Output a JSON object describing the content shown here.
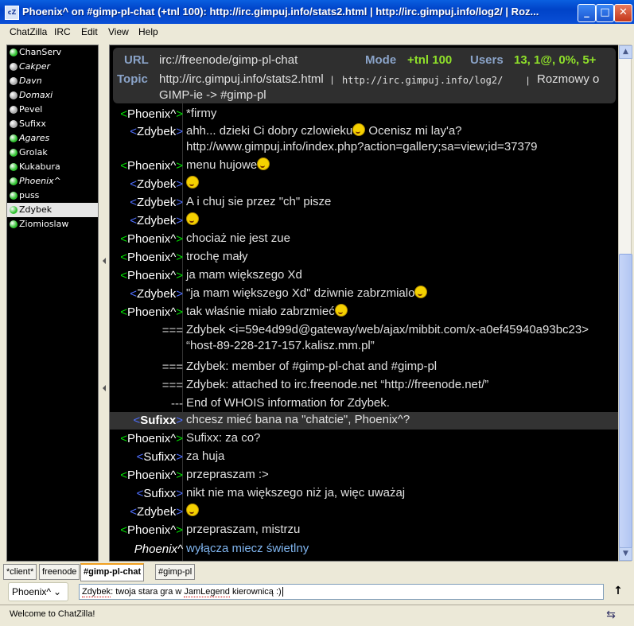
{
  "window": {
    "title": "Phoenix^ on #gimp-pl-chat (+tnl 100): http://irc.gimpuj.info/stats2.html | http://irc.gimpuj.info/log2/ | Roz...",
    "app_icon": "cZ",
    "minimize": "_",
    "maximize": "□",
    "close": "✕"
  },
  "menu": [
    "ChatZilla",
    "IRC",
    "Edit",
    "View",
    "Help"
  ],
  "users": [
    {
      "name": "ChanServ",
      "color": "#2ec12e",
      "italic": false,
      "selected": false
    },
    {
      "name": "Cakper",
      "color": "#aaaaaa",
      "italic": true,
      "selected": false
    },
    {
      "name": "Davn",
      "color": "#aaaaaa",
      "italic": true,
      "selected": false
    },
    {
      "name": "Domaxi",
      "color": "#aaaaaa",
      "italic": true,
      "selected": false
    },
    {
      "name": "Pevel",
      "color": "#aaaaaa",
      "italic": false,
      "selected": false
    },
    {
      "name": "Sufixx",
      "color": "#aaaaaa",
      "italic": false,
      "selected": false
    },
    {
      "name": "Agares",
      "color": "#2ec12e",
      "italic": true,
      "selected": false
    },
    {
      "name": "Grolak",
      "color": "#2ec12e",
      "italic": false,
      "selected": false
    },
    {
      "name": "Kukabura",
      "color": "#2ec12e",
      "italic": false,
      "selected": false
    },
    {
      "name": "Phoenix^",
      "color": "#2ec12e",
      "italic": true,
      "selected": false
    },
    {
      "name": "puss",
      "color": "#2ec12e",
      "italic": false,
      "selected": false
    },
    {
      "name": "Zdybek",
      "color": "#2ec12e",
      "italic": false,
      "selected": true
    },
    {
      "name": "Ziomioslaw",
      "color": "#2ec12e",
      "italic": false,
      "selected": false
    }
  ],
  "header": {
    "url_label": "URL",
    "url_value": "irc://freenode/gimp-pl-chat",
    "mode_label": "Mode",
    "mode_value": "+tnl 100",
    "users_label": "Users",
    "users_value": "13, 1@, 0%, 5+",
    "topic_label": "Topic",
    "topic_link1": "http://irc.gimpuj.info/stats2.html",
    "topic_sep": "|",
    "topic_link2": "http://irc.gimpuj.info/log2/",
    "topic_rest": "Rozmowy o",
    "topic_line2": "GIMP-ie -> #gimp-pl"
  },
  "messages": [
    {
      "nick": "Phoenix^",
      "style": "green",
      "text": "*firmy",
      "smiley": false
    },
    {
      "nick": "Zdybek",
      "style": "blue",
      "text": "ahh... dzieki Ci dobry czlowieku",
      "smiley": true,
      "text2": " Ocenisz mi lay'a? http://www.gimpuj.info/index.php?action=gallery;sa=view;id=37379"
    },
    {
      "nick": "Phoenix^",
      "style": "green",
      "text": "menu hujowe",
      "smiley": true
    },
    {
      "nick": "Zdybek",
      "style": "blue",
      "text": "",
      "smiley": true
    },
    {
      "nick": "Zdybek",
      "style": "blue",
      "text": "A i chuj sie przez \"ch\" pisze",
      "smiley": false
    },
    {
      "nick": "Zdybek",
      "style": "blue",
      "text": "",
      "smiley": true
    },
    {
      "nick": "Phoenix^",
      "style": "green",
      "text": "chociaż nie jest zue",
      "smiley": false
    },
    {
      "nick": "Phoenix^",
      "style": "green",
      "text": "trochę mały",
      "smiley": false
    },
    {
      "nick": "Phoenix^",
      "style": "green",
      "text": "ja mam większego Xd",
      "smiley": false
    },
    {
      "nick": "Zdybek",
      "style": "blue",
      "text": "\"ja mam większego Xd\" dziwnie zabrzmialo",
      "smiley": true
    },
    {
      "nick": "Phoenix^",
      "style": "green",
      "text": "tak właśnie miało zabrzmieć",
      "smiley": true
    },
    {
      "nick": "===",
      "style": "info",
      "text": "Zdybek <i=59e4d99d@gateway/web/ajax/mibbit.com/x-a0ef45940a93bc23> “host-89-228-217-157.kalisz.mm.pl”",
      "smiley": false
    },
    {
      "nick": "===",
      "style": "info",
      "text": "Zdybek: member of #gimp-pl-chat and #gimp-pl",
      "smiley": false
    },
    {
      "nick": "===",
      "style": "info",
      "text": "Zdybek: attached to irc.freenode.net “http://freenode.net/”",
      "smiley": false
    },
    {
      "nick": "---",
      "style": "info",
      "text": "End of WHOIS information for Zdybek.",
      "smiley": false
    },
    {
      "nick": "Sufixx",
      "style": "blue-hl",
      "text": "chcesz mieć bana na \"chatcie\", Phoenix^?",
      "smiley": false
    },
    {
      "nick": "Phoenix^",
      "style": "green",
      "text": "Sufixx: za co?",
      "smiley": false
    },
    {
      "nick": "Sufixx",
      "style": "blue",
      "text": "za huja",
      "smiley": false
    },
    {
      "nick": "Phoenix^",
      "style": "green",
      "text": "przepraszam :>",
      "smiley": false
    },
    {
      "nick": "Sufixx",
      "style": "blue",
      "text": "nikt nie ma większego niż ja, więc uważaj",
      "smiley": false
    },
    {
      "nick": "Zdybek",
      "style": "blue",
      "text": "",
      "smiley": true
    },
    {
      "nick": "Phoenix^",
      "style": "green",
      "text": "przepraszam, mistrzu",
      "smiley": false
    },
    {
      "nick": "Phoenix^",
      "style": "action",
      "text": "wyłącza miecz świetlny",
      "smiley": false
    }
  ],
  "tabs": [
    "*client*",
    "freenode",
    "#gimp-pl-chat",
    "#gimp-pl"
  ],
  "active_tab": 2,
  "input": {
    "nick": "Phoenix^",
    "value": "Zdybek: twoja stara gra w JamLegend kierownicą :)",
    "multiline_icon": "up-arrow-icon"
  },
  "status": {
    "text": "Welcome to ChatZilla!",
    "network_icon": "network-icon"
  },
  "colors": {
    "accent": "#8fe02a",
    "header_label": "#8aa3c8",
    "action": "#7fb4ee",
    "nick_bracket_blue": "#4f6fff",
    "nick_green": "#00e000"
  }
}
